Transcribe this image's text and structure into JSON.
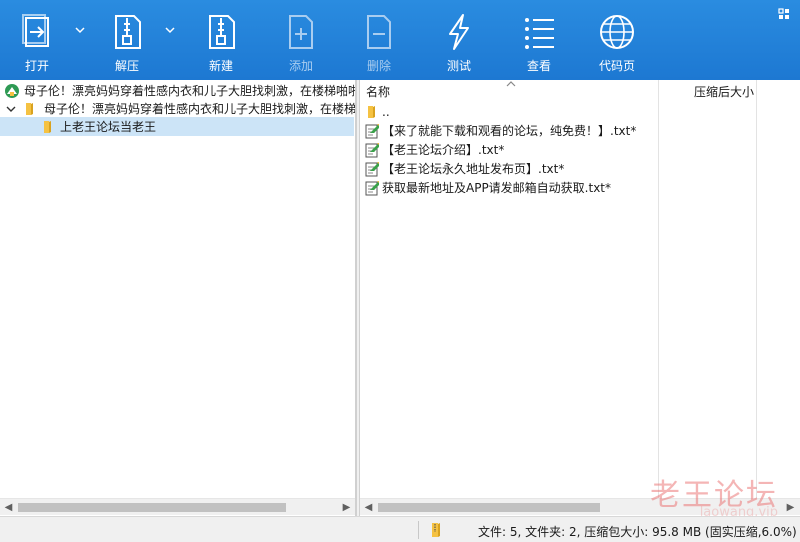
{
  "toolbar": {
    "open": "打开",
    "extract": "解压",
    "new": "新建",
    "add": "添加",
    "delete": "删除",
    "test": "测试",
    "view": "查看",
    "codepage": "代码页"
  },
  "tree": {
    "root": "母子伦！漂亮妈妈穿着性感内衣和儿子大胆找刺激，在楼梯啪啪",
    "folder": "母子伦！漂亮妈妈穿着性感内衣和儿子大胆找刺激，在楼梯啪",
    "child": "上老王论坛当老王"
  },
  "list": {
    "col_name": "名称",
    "col_size": "压缩后大小",
    "items": [
      {
        "name": "..",
        "icon": "folder-icon"
      },
      {
        "name": "【来了就能下载和观看的论坛，纯免费！】.txt*",
        "icon": "text-file-icon"
      },
      {
        "name": "【老王论坛介绍】.txt*",
        "icon": "text-file-icon"
      },
      {
        "name": "【老王论坛永久地址发布页】.txt*",
        "icon": "text-file-icon"
      },
      {
        "name": "获取最新地址及APP请发邮箱自动获取.txt*",
        "icon": "text-file-icon"
      }
    ]
  },
  "status": {
    "summary": "文件: 5, 文件夹: 2, 压缩包大小: 95.8 MB (固实压缩,6.0%)"
  },
  "watermark": {
    "main": "老王论坛",
    "sub": "laowang.vip"
  },
  "colors": {
    "toolbar": "#1d78d2",
    "selection": "#cce4f7",
    "folder": "#f5c242"
  }
}
